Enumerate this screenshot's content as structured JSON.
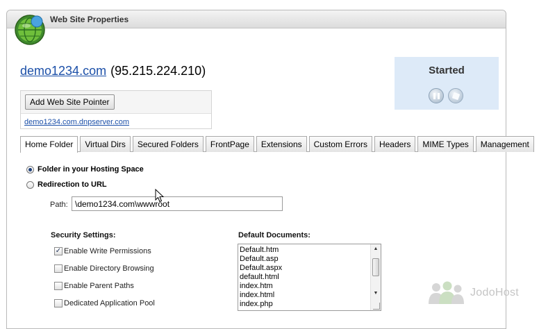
{
  "panel": {
    "title": "Web Site Properties"
  },
  "site": {
    "domain": "demo1234.com",
    "ip": "(95.215.224.210)",
    "add_pointer_label": "Add Web Site Pointer",
    "pointer_domain": "demo1234.com.dnpserver.com"
  },
  "status": {
    "text": "Started"
  },
  "tabs": [
    {
      "label": "Home Folder"
    },
    {
      "label": "Virtual Dirs"
    },
    {
      "label": "Secured Folders"
    },
    {
      "label": "FrontPage"
    },
    {
      "label": "Extensions"
    },
    {
      "label": "Custom Errors"
    },
    {
      "label": "Headers"
    },
    {
      "label": "MIME Types"
    },
    {
      "label": "Management"
    }
  ],
  "home_folder": {
    "option_hosting": "Folder in your Hosting Space",
    "option_redirect": "Redirection to URL",
    "path_label": "Path:",
    "path_value": "\\demo1234.com\\wwwroot",
    "security_heading": "Security Settings:",
    "security": [
      {
        "label": "Enable Write Permissions"
      },
      {
        "label": "Enable Directory Browsing"
      },
      {
        "label": "Enable Parent Paths"
      },
      {
        "label": "Dedicated Application Pool"
      }
    ],
    "documents_heading": "Default Documents:",
    "documents": [
      "Default.htm",
      "Default.asp",
      "Default.aspx",
      "default.html",
      "index.htm",
      "index.html",
      "index.php"
    ]
  },
  "watermark": {
    "text": "JodoHost"
  },
  "colors": {
    "link": "#1b4fa8",
    "status_bg": "#ddeaf8"
  }
}
